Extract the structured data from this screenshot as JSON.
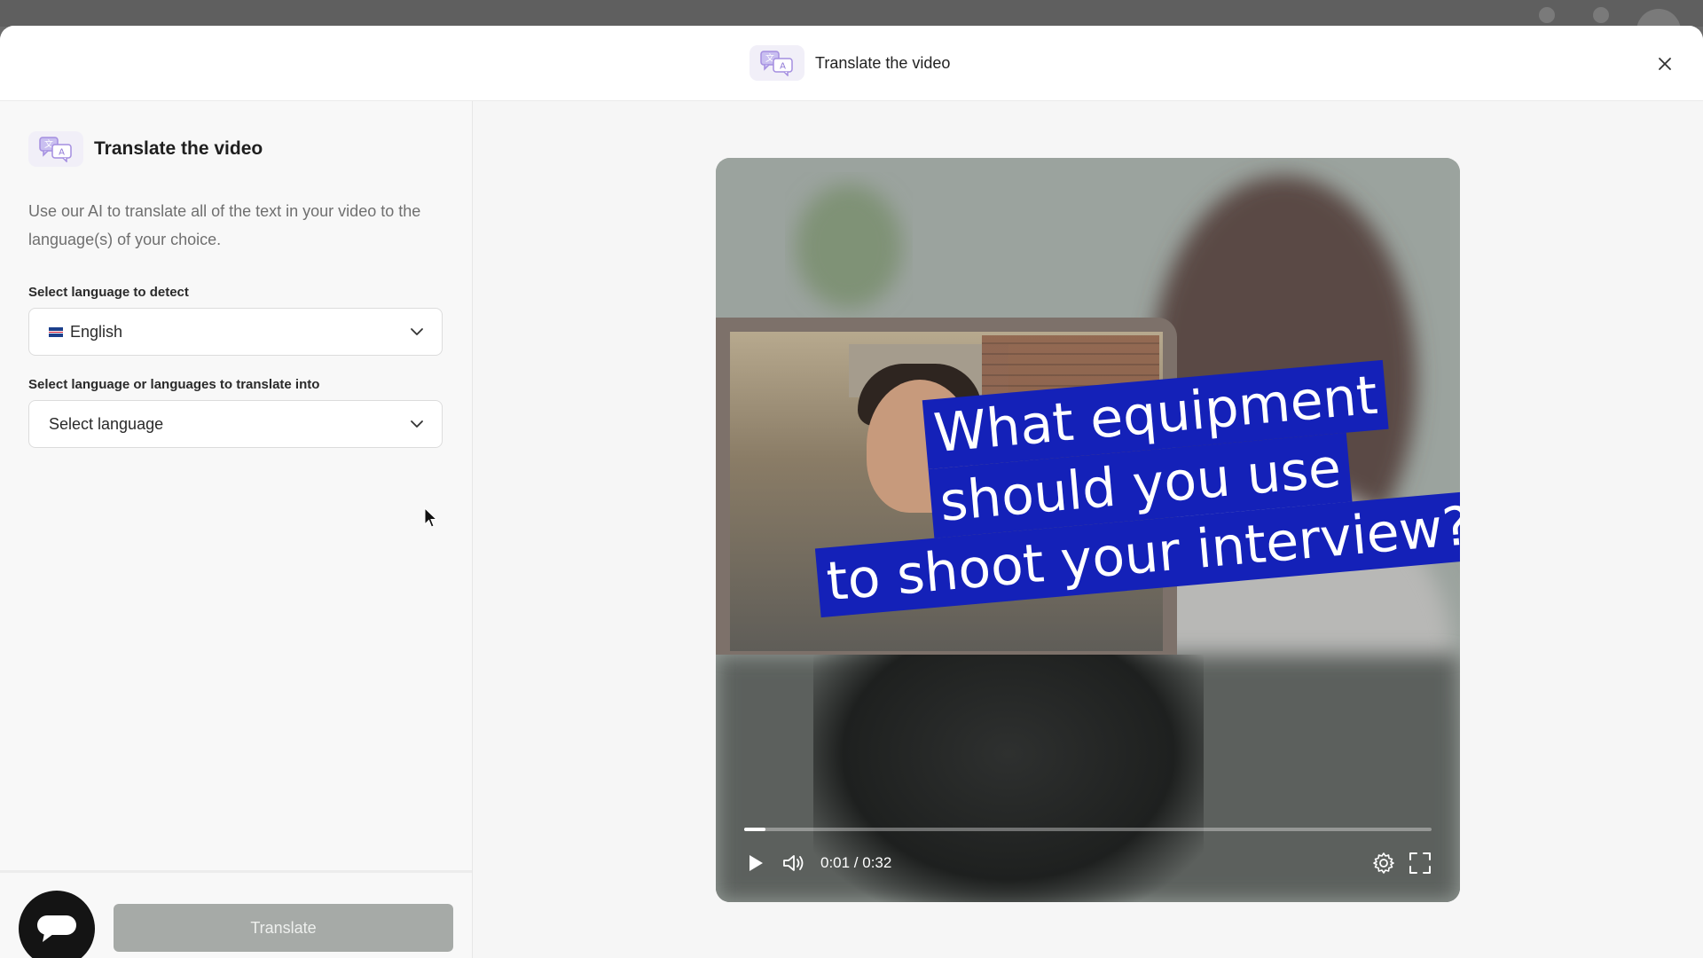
{
  "modal": {
    "title": "Translate the video"
  },
  "panel": {
    "title": "Translate the video",
    "description": "Use our AI to translate all of the text in your video to the language(s) of your choice.",
    "detect_label": "Select language to detect",
    "detect_value": "English",
    "translate_label": "Select language or languages to translate into",
    "translate_placeholder": "Select language",
    "translate_button": "Translate"
  },
  "video": {
    "caption_lines": [
      "What equipment",
      "should you use",
      "to shoot your interview?"
    ],
    "current_time": "0:01",
    "duration": "0:32",
    "time_display": "0:01 / 0:32",
    "progress_fraction": 0.031
  },
  "colors": {
    "caption_bg": "#1421b8",
    "button_disabled": "#a6aaa7",
    "icon_tint": "#a48ee0"
  },
  "icons": [
    "translate-icon",
    "close-icon",
    "chevron-down-icon",
    "chat-icon",
    "play-icon",
    "volume-icon",
    "settings-icon",
    "fullscreen-icon"
  ]
}
